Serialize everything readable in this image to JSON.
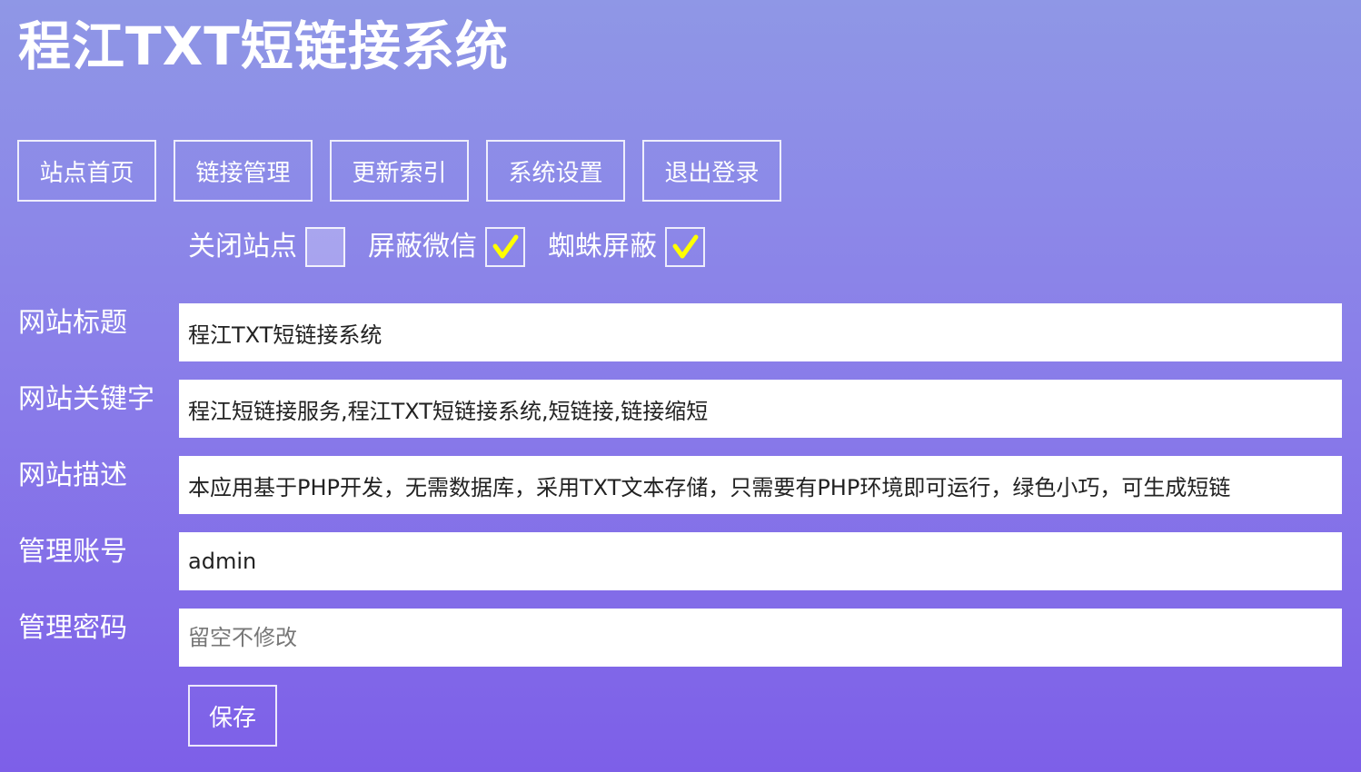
{
  "app": {
    "title": "程江TXT短链接系统"
  },
  "nav": {
    "items": [
      {
        "label": "站点首页"
      },
      {
        "label": "链接管理"
      },
      {
        "label": "更新索引"
      },
      {
        "label": "系统设置"
      },
      {
        "label": "退出登录"
      }
    ]
  },
  "toggles": [
    {
      "label": "关闭站点",
      "checked": false
    },
    {
      "label": "屏蔽微信",
      "checked": true
    },
    {
      "label": "蜘蛛屏蔽",
      "checked": true
    }
  ],
  "form": {
    "site_title": {
      "label": "网站标题",
      "value": "程江TXT短链接系统"
    },
    "site_keywords": {
      "label": "网站关键字",
      "value": "程江短链接服务,程江TXT短链接系统,短链接,链接缩短"
    },
    "site_description": {
      "label": "网站描述",
      "value": "本应用基于PHP开发，无需数据库，采用TXT文本存储，只需要有PHP环境即可运行，绿色小巧，可生成短链"
    },
    "admin_account": {
      "label": "管理账号",
      "value": "admin"
    },
    "admin_password": {
      "label": "管理密码",
      "value": "",
      "placeholder": "留空不修改"
    }
  },
  "save_label": "保存",
  "colors": {
    "checkmark": "#ffff00",
    "gradient_top": "#8f97e6",
    "gradient_bottom": "#7d5fe8"
  },
  "icons": {
    "checkmark": "checkmark-icon"
  }
}
